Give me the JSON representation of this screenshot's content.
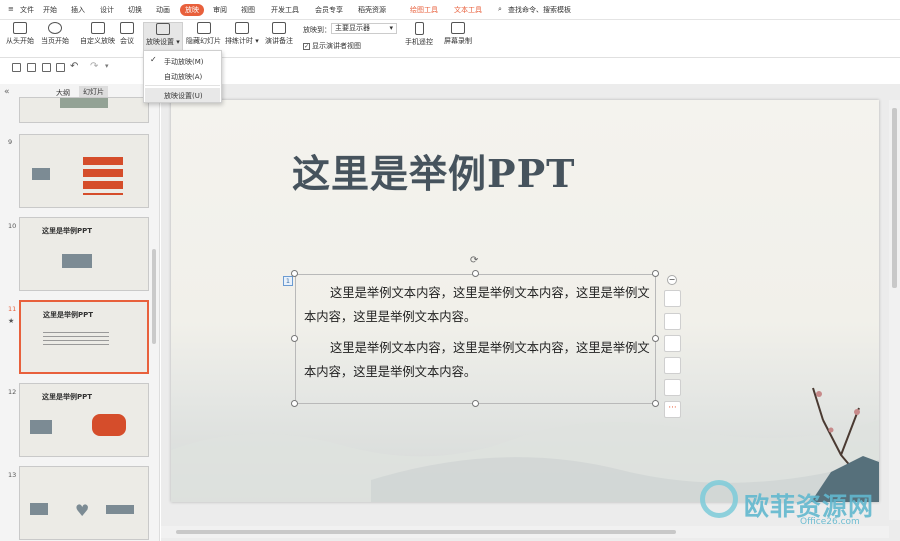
{
  "menubar": {
    "hamburger": "≡",
    "file": "文件",
    "items": [
      "开始",
      "插入",
      "设计",
      "切换",
      "动画",
      "放映",
      "审阅",
      "视图",
      "开发工具",
      "会员专享",
      "稻壳资源"
    ],
    "active": "放映",
    "contextual": [
      "绘图工具",
      "文本工具"
    ],
    "search": "查找命令、搜索模板"
  },
  "ribbon": {
    "from_start": "从头开始",
    "from_current": "当页开始",
    "custom": "自定义放映",
    "meeting": "会议",
    "settings": "放映设置",
    "hide": "隐藏幻灯片",
    "rehearse": "排练计时",
    "notes": "演讲备注",
    "show_to_label": "放映到：",
    "show_to_value": "主要显示器",
    "presenter_view": "显示演讲者视图",
    "phone_remote": "手机遥控",
    "screen_record": "屏幕录制"
  },
  "dropdown": {
    "manual": "手动放映(M)",
    "auto": "自动放映(A)",
    "settings": "放映设置(U)"
  },
  "panel": {
    "collapse": "«",
    "tab_outline": "大纲",
    "tab_slides": "幻灯片"
  },
  "thumbs": [
    {
      "num": "9",
      "title": ""
    },
    {
      "num": "10",
      "title": "这里是举例PPT"
    },
    {
      "num": "11",
      "title": "这里是举例PPT"
    },
    {
      "num": "12",
      "title": "这里是举例PPT"
    },
    {
      "num": "13",
      "title": ""
    }
  ],
  "slide": {
    "title": "这里是举例PPT",
    "para1": "这里是举例文本内容，这里是举例文本内容，这里是举例文本内容，这里是举例文本内容。",
    "para2": "这里是举例文本内容，这里是举例文本内容，这里是举例文本内容，这里是举例文本内容。",
    "anim_badge": "1"
  },
  "watermark": {
    "text": "欧菲资源网",
    "sub": "Office26.com"
  }
}
